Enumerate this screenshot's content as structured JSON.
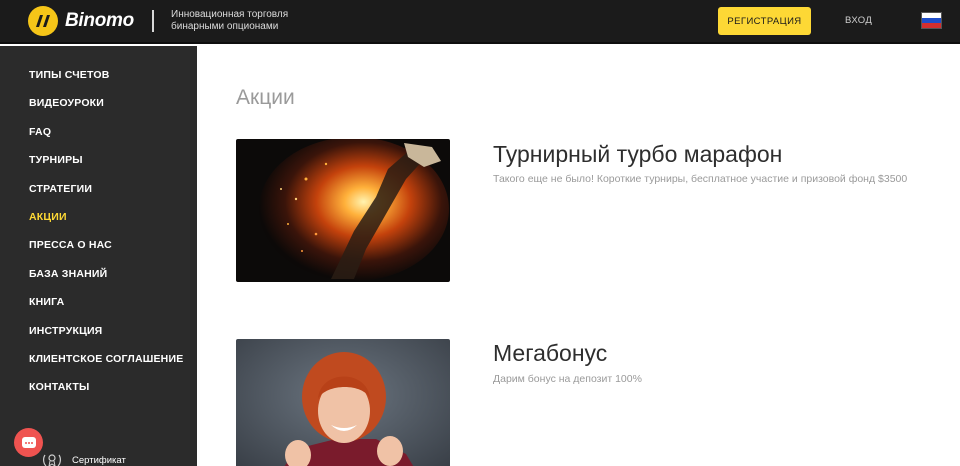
{
  "header": {
    "logo_text": "Binomo",
    "tagline": "Инновационная торговля бинарными опционами",
    "register_label": "РЕГИСТРАЦИЯ",
    "login_label": "ВХОД",
    "language_flag": "flag-ru-icon",
    "accent_color": "#fdd835"
  },
  "sidebar": {
    "items": [
      {
        "label": "ТИПЫ СЧЕТОВ"
      },
      {
        "label": "ВИДЕОУРОКИ"
      },
      {
        "label": "FAQ"
      },
      {
        "label": "ТУРНИРЫ"
      },
      {
        "label": "СТРАТЕГИИ"
      },
      {
        "label": "АКЦИИ"
      },
      {
        "label": "ПРЕССА О НАС"
      },
      {
        "label": "БАЗА ЗНАНИЙ"
      },
      {
        "label": "КНИГА"
      },
      {
        "label": "ИНСТРУКЦИЯ"
      },
      {
        "label": "КЛИЕНТСКОЕ СОГЛАШЕНИЕ"
      },
      {
        "label": "КОНТАКТЫ"
      }
    ],
    "active_index": 5,
    "certificate_label": "Сертификат",
    "chat_icon": "chat-icon"
  },
  "main": {
    "title": "Акции",
    "promos": [
      {
        "title": "Турнирный турбо марафон",
        "description": "Такого еще не было! Короткие турниры, бесплатное участие и призовой фонд $3500"
      },
      {
        "title": "Мегабонус",
        "description": "Дарим бонус на депозит 100%"
      }
    ]
  }
}
